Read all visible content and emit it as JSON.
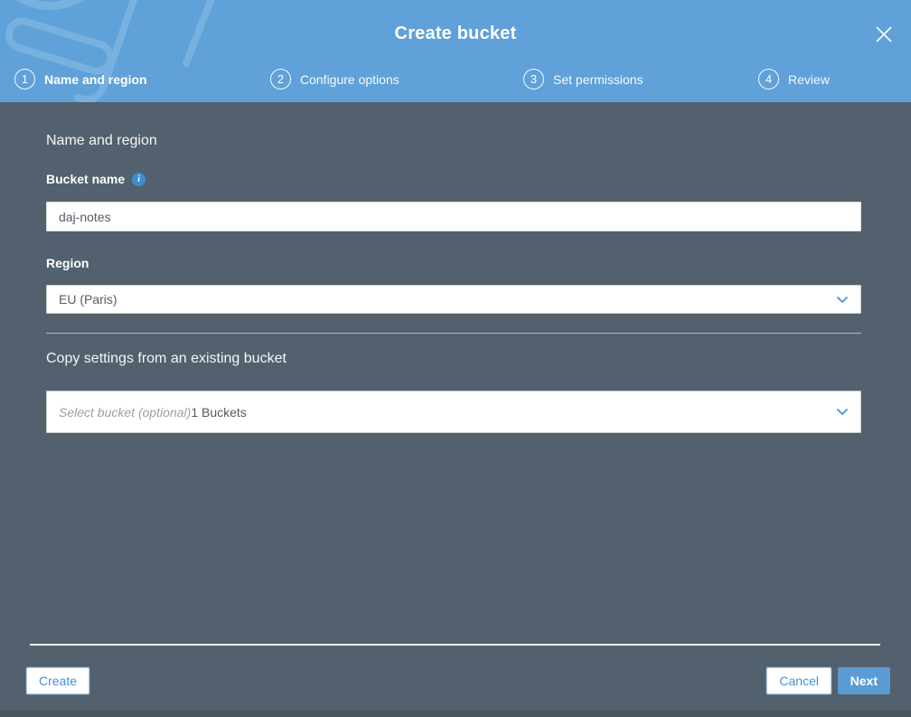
{
  "colors": {
    "header_blue": "#5fa1d8",
    "watermark_blue": "#83b8e2",
    "body_bg": "#52616d",
    "accent_blue": "#4a90cf",
    "next_button_bg": "#5a9bd5",
    "input_text": "#545b64",
    "placeholder_text": "#9b9fa5",
    "info_icon_bg": "#3f8dd1"
  },
  "header": {
    "title": "Create bucket"
  },
  "icons": {
    "close_glyph": "✕",
    "info_glyph": "i"
  },
  "steps": [
    {
      "number": "1",
      "label": "Name and region",
      "active": true
    },
    {
      "number": "2",
      "label": "Configure options",
      "active": false
    },
    {
      "number": "3",
      "label": "Set permissions",
      "active": false
    },
    {
      "number": "4",
      "label": "Review",
      "active": false
    }
  ],
  "form": {
    "section_title": "Name and region",
    "bucket_name_label": "Bucket name",
    "bucket_name_value": "daj-notes",
    "region_label": "Region",
    "region_value": "EU (Paris)",
    "copy_settings_title": "Copy settings from an existing bucket",
    "copy_bucket_placeholder": "Select bucket (optional)",
    "copy_bucket_count": "1 Buckets"
  },
  "footer": {
    "create_label": "Create",
    "cancel_label": "Cancel",
    "next_label": "Next"
  }
}
